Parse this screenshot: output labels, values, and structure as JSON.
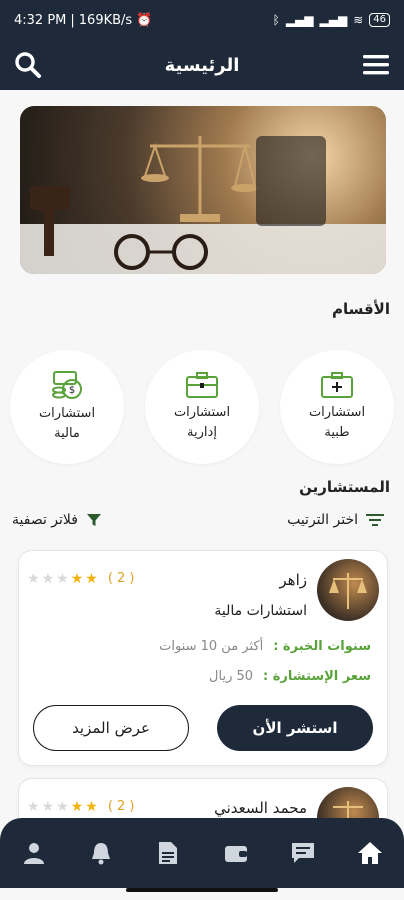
{
  "status_bar": {
    "time": "4:32 PM",
    "speed": "169KB/s",
    "battery": "46"
  },
  "header": {
    "title": "الرئيسية"
  },
  "sections": {
    "categories_title": "الأقسام",
    "consultants_title": "المستشارين"
  },
  "categories": [
    {
      "line1": "استشارات",
      "line2": "طبية",
      "icon": "medical-kit-icon"
    },
    {
      "line1": "استشارات",
      "line2": "إدارية",
      "icon": "briefcase-icon"
    },
    {
      "line1": "استشارات",
      "line2": "مالية",
      "icon": "money-coins-icon"
    }
  ],
  "filters": {
    "sort_label": "اختر الترتيب",
    "filter_label": "فلاتر تصفية"
  },
  "consultants": [
    {
      "name": "زاهر",
      "field": "استشارات مالية",
      "rating_count": "( 2 )",
      "stars": 2,
      "experience_label": "سنوات الخبرة :",
      "experience_value": "أكثر من 10 سنوات",
      "price_label": "سعر الإستشارة :",
      "price_value": "50 ريال",
      "consult_button": "استشر الأن",
      "more_button": "عرض المزيد"
    },
    {
      "name": "محمد السعدني",
      "rating_count": "( 2 )",
      "stars": 2
    }
  ],
  "bottom_nav": [
    "home-icon",
    "chat-icon",
    "wallet-icon",
    "document-icon",
    "bell-icon",
    "profile-icon"
  ],
  "colors": {
    "primary": "#1e2a3a",
    "accent_green": "#5aa33a",
    "star": "#f2b30f",
    "rating": "#e0a326"
  }
}
